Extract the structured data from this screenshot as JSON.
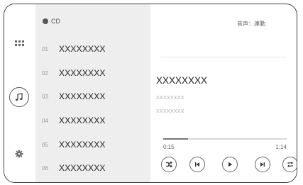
{
  "sidebar": {
    "items": [
      {
        "icon": "apps-grid-icon"
      },
      {
        "icon": "music-note-icon",
        "selected": true
      },
      {
        "icon": "settings-gear-icon"
      }
    ]
  },
  "source": {
    "label": "CD"
  },
  "tracks": [
    {
      "num": "01",
      "title": "XXXXXXXX"
    },
    {
      "num": "02",
      "title": "XXXXXXXX"
    },
    {
      "num": "03",
      "title": "XXXXXXXX"
    },
    {
      "num": "04",
      "title": "XXXXXXXX"
    },
    {
      "num": "05",
      "title": "XXXXXXXX"
    },
    {
      "num": "06",
      "title": "XXXXXXXX"
    }
  ],
  "now_playing": {
    "sound_mode": "音声：連動",
    "title": "XXXXXXXX",
    "artist": "XXXXXXXX",
    "album": "XXXXXXXX",
    "elapsed": "0:15",
    "duration": "1:14",
    "progress_fraction": 0.2
  },
  "controls": [
    "shuffle-icon",
    "previous-track-icon",
    "play-icon",
    "next-track-icon",
    "repeat-icon"
  ]
}
